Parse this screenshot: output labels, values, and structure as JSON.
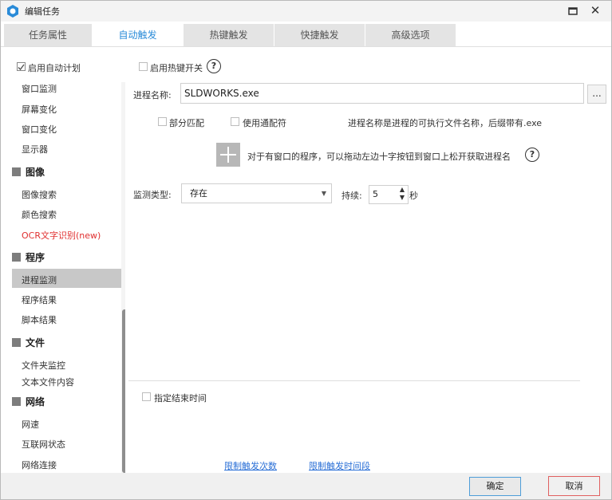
{
  "window": {
    "title": "编辑任务"
  },
  "tabs": [
    {
      "label": "任务属性",
      "active": false
    },
    {
      "label": "自动触发",
      "active": true
    },
    {
      "label": "热键触发",
      "active": false
    },
    {
      "label": "快捷触发",
      "active": false
    },
    {
      "label": "高级选项",
      "active": false
    }
  ],
  "sidebar": {
    "enable_schedule": {
      "label": "启用自动计划",
      "checked": true
    },
    "items_top": [
      "窗口监测",
      "屏幕变化",
      "窗口变化",
      "显示器"
    ],
    "section_image": {
      "label": "图像",
      "items": [
        "图像搜索",
        "颜色搜索",
        "OCR文字识别(new)"
      ]
    },
    "section_program": {
      "label": "程序",
      "items": [
        "进程监测",
        "程序结果",
        "脚本结果"
      ],
      "selected": "进程监测"
    },
    "section_file": {
      "label": "文件",
      "items": [
        "文件夹监控",
        "文本文件内容"
      ]
    },
    "section_network": {
      "label": "网络",
      "items": [
        "网速",
        "互联网状态",
        "网络连接"
      ]
    }
  },
  "main": {
    "hotkey_toggle": {
      "label": "启用热键开关",
      "checked": false
    },
    "process_label": "进程名称:",
    "process_value": "SLDWORKS.exe",
    "browse_label": "...",
    "partial_match": {
      "label": "部分匹配",
      "checked": false
    },
    "wildcard": {
      "label": "使用通配符",
      "checked": false
    },
    "process_hint": "进程名称是进程的可执行文件名称，后缀带有.exe",
    "drag_hint": "对于有窗口的程序，可以拖动左边十字按钮到窗口上松开获取进程名",
    "monitor_type_label": "监测类型:",
    "monitor_type_value": "存在",
    "duration_label": "持续:",
    "duration_value": "5",
    "duration_unit": "秒",
    "end_time": {
      "label": "指定结束时间",
      "checked": false
    },
    "link_limit_count": "限制触发次数",
    "link_limit_period": "限制触发时间段"
  },
  "footer": {
    "ok_label": "确定",
    "cancel_label": "取消"
  },
  "colors": {
    "accent": "#2a8bd8",
    "selected_bg": "#c8c8c8",
    "cancel_border": "#e06060",
    "ok_border": "#4e9dd8"
  }
}
